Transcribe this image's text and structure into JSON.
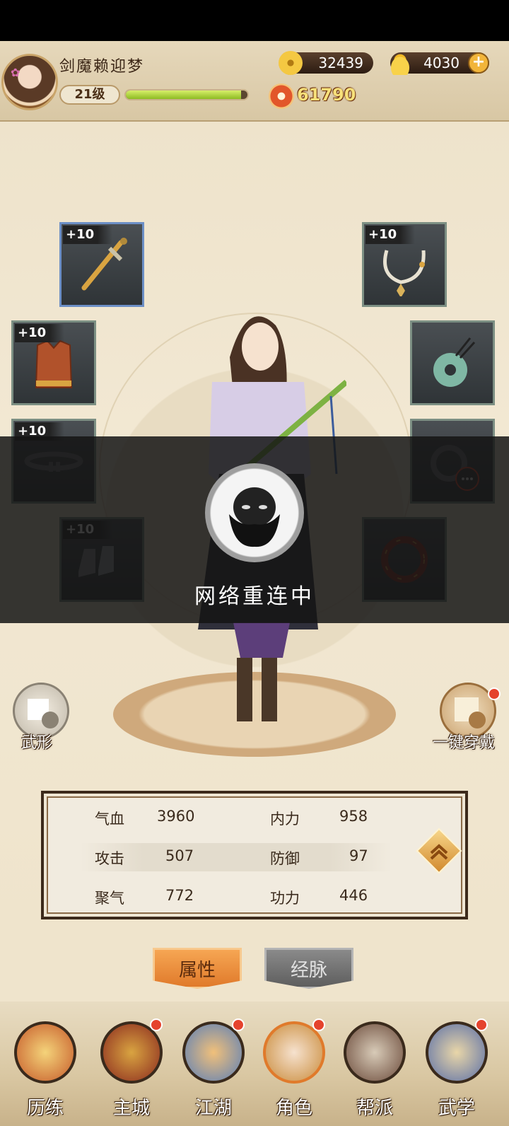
{
  "player": {
    "name": "剑魔赖迎梦",
    "level": "21级",
    "exp_progress": 0.95,
    "power": "61790"
  },
  "resources": {
    "coins": "32439",
    "gold": "4030",
    "plus_symbol": "+"
  },
  "equipment": {
    "tag": "+10"
  },
  "side_buttons": {
    "wuxing": "武形",
    "one_click_wear": "一键穿戴"
  },
  "overlay": {
    "message": "网络重连中"
  },
  "stats": {
    "rows": [
      [
        {
          "name": "气血",
          "value": "3960"
        },
        {
          "name": "内力",
          "value": "958"
        }
      ],
      [
        {
          "name": "攻击",
          "value": "507"
        },
        {
          "name": "防御",
          "value": "97"
        }
      ],
      [
        {
          "name": "聚气",
          "value": "772"
        },
        {
          "name": "功力",
          "value": "446"
        }
      ]
    ]
  },
  "tabs": {
    "attributes": "属性",
    "meridians": "经脉"
  },
  "nav": [
    {
      "label": "历练",
      "icon": "training-icon"
    },
    {
      "label": "主城",
      "icon": "main-city-icon"
    },
    {
      "label": "江湖",
      "icon": "jianghu-icon"
    },
    {
      "label": "角色",
      "icon": "character-icon"
    },
    {
      "label": "帮派",
      "icon": "guild-icon"
    },
    {
      "label": "武学",
      "icon": "martial-arts-icon"
    }
  ],
  "colors": {
    "accent_orange": "#e07a2b",
    "notification_red": "#e5432d",
    "exp_green": "#8dbb22"
  }
}
